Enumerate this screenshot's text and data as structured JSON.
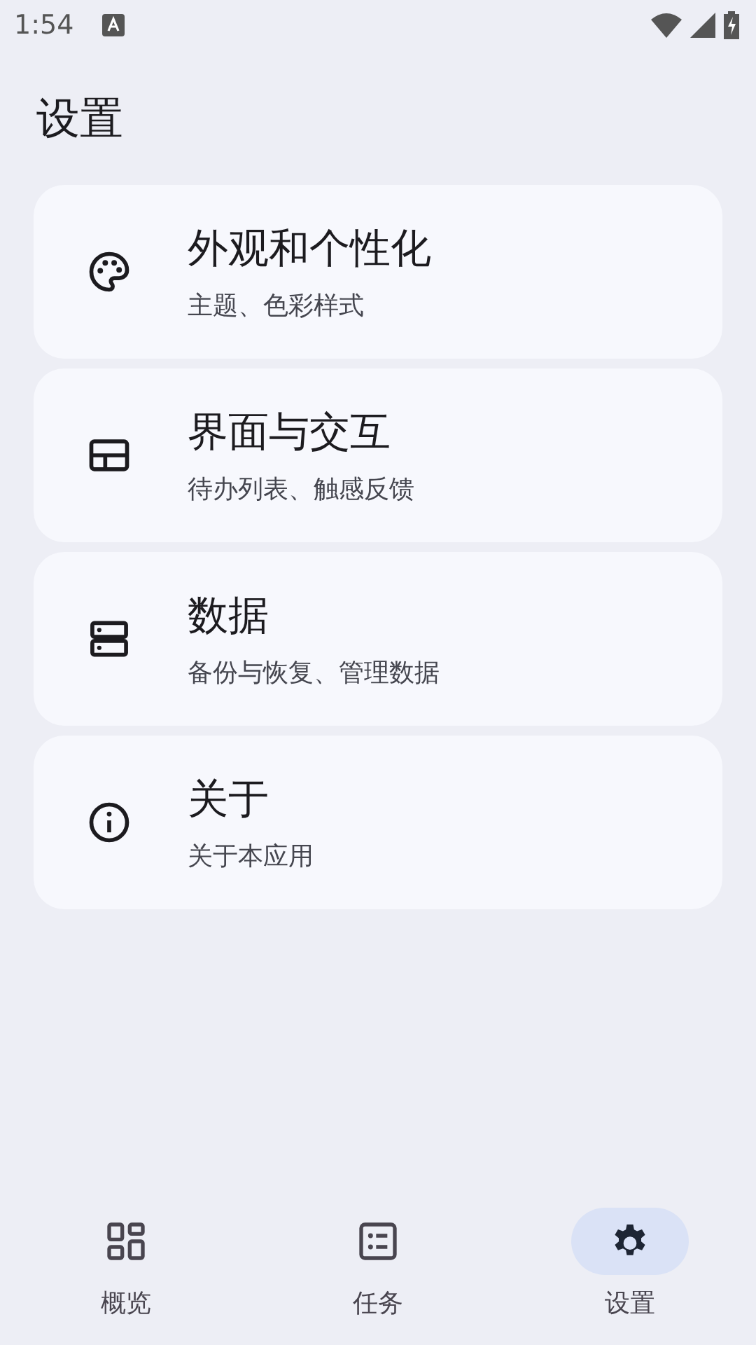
{
  "status_bar": {
    "time": "1:54"
  },
  "title": "设置",
  "settings": [
    {
      "kind": "palette",
      "title": "外观和个性化",
      "subtitle": "主题、色彩样式"
    },
    {
      "kind": "layout",
      "title": "界面与交互",
      "subtitle": "待办列表、触感反馈"
    },
    {
      "kind": "storage",
      "title": "数据",
      "subtitle": "备份与恢复、管理数据"
    },
    {
      "kind": "info",
      "title": "关于",
      "subtitle": "关于本应用"
    }
  ],
  "nav": [
    {
      "kind": "dashboard",
      "label": "概览",
      "selected": false
    },
    {
      "kind": "tasks",
      "label": "任务",
      "selected": false
    },
    {
      "kind": "settings",
      "label": "设置",
      "selected": true
    }
  ]
}
